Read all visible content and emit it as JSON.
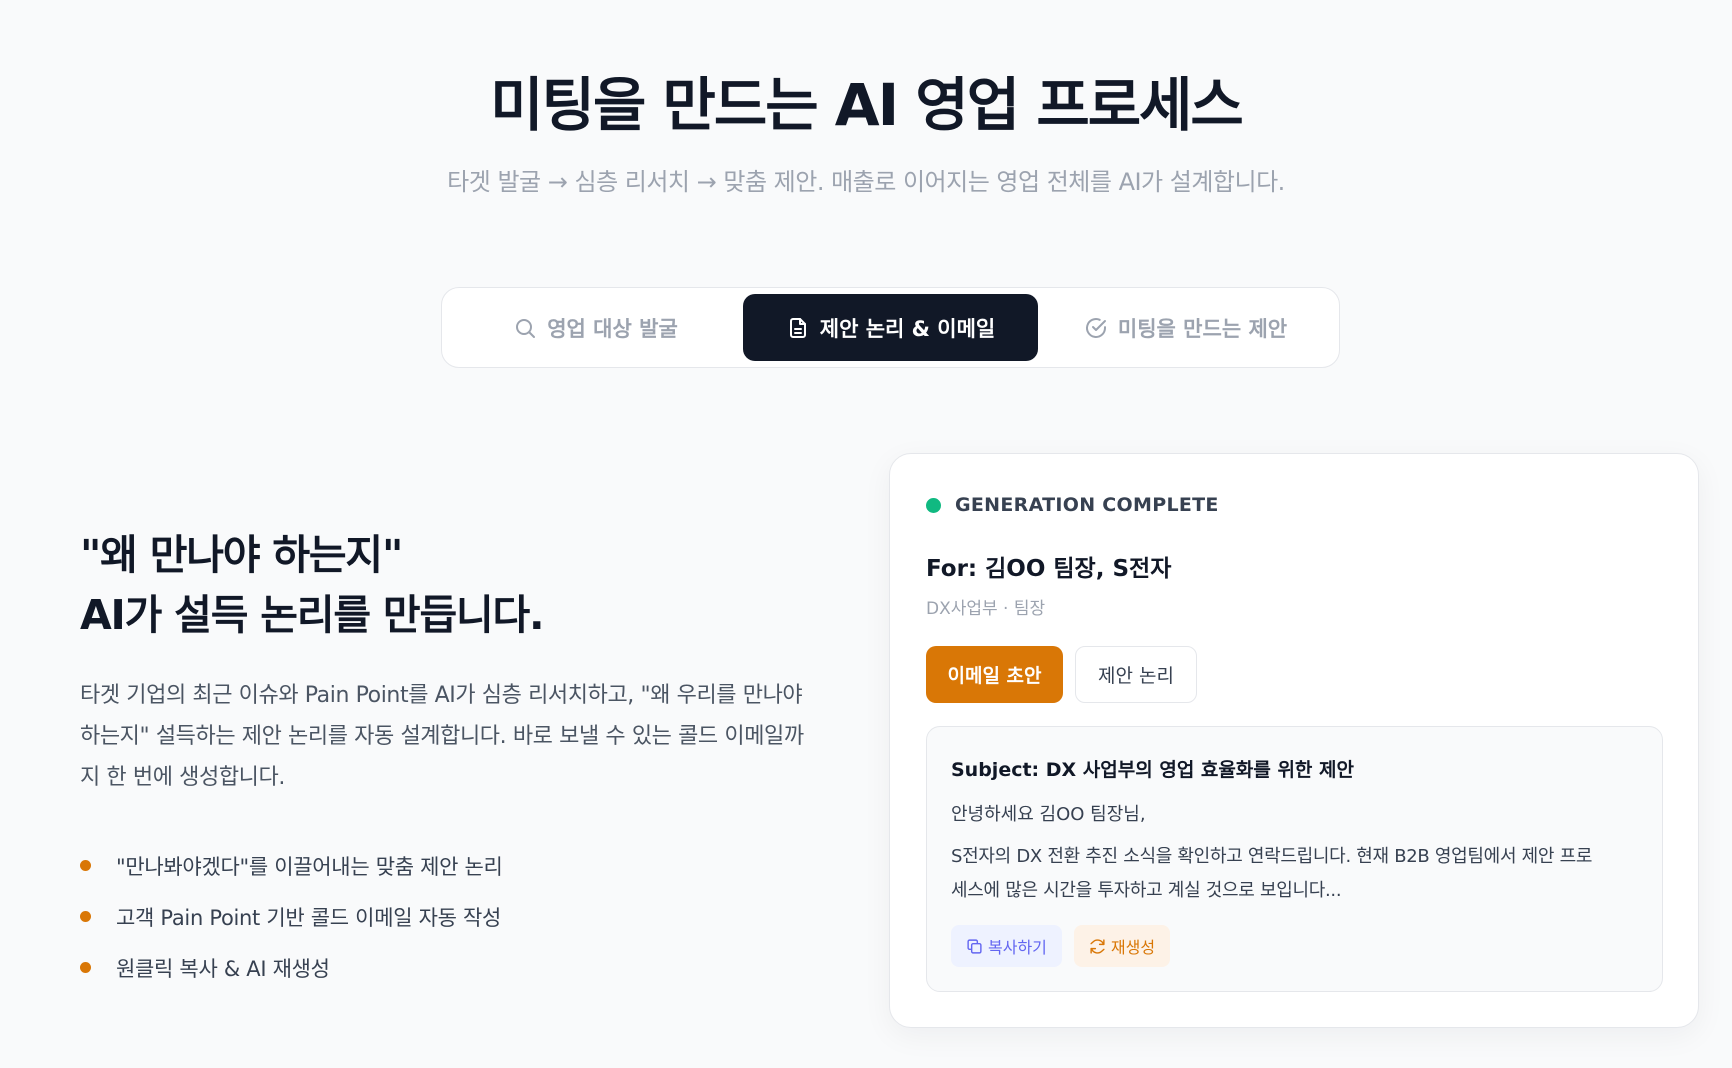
{
  "hero": {
    "title": "미팅을 만드는 AI 영업 프로세스",
    "subtitle": "타겟 발굴 → 심층 리서치 → 맞춤 제안. 매출로 이어지는 영업 전체를 AI가 설계합니다."
  },
  "tabs": [
    {
      "label": "영업 대상 발굴",
      "icon": "search-icon",
      "active": false
    },
    {
      "label": "제안 논리 & 이메일",
      "icon": "document-icon",
      "active": true
    },
    {
      "label": "미팅을 만드는 제안",
      "icon": "check-circle-icon",
      "active": false
    }
  ],
  "feature": {
    "heading_line1": "\"왜 만나야 하는지\"",
    "heading_line2": "AI가 설득 논리를 만듭니다.",
    "description": "타겟 기업의 최근 이슈와 Pain Point를 AI가 심층 리서치하고, \"왜 우리를 만나야 하는지\" 설득하는 제안 논리를 자동 설계합니다. 바로 보낼 수 있는 콜드 이메일까지 한 번에 생성합니다.",
    "bullets": [
      "\"만나봐야겠다\"를 이끌어내는 맞춤 제안 논리",
      "고객 Pain Point 기반 콜드 이메일 자동 작성",
      "원클릭 복사 & AI 재생성"
    ],
    "accent": "#d97706"
  },
  "card": {
    "status": "GENERATION COMPLETE",
    "status_color": "#10b981",
    "for_line": "For: 김OO 팀장, S전자",
    "dept": "DX사업부 · 팀장",
    "btn_email": "이메일 초안",
    "btn_logic": "제안 논리",
    "email": {
      "subject": "Subject: DX 사업부의 영업 효율화를 위한 제안",
      "greeting": "안녕하세요 김OO 팀장님,",
      "body": "S전자의 DX 전환 추진 소식을 확인하고 연락드립니다. 현재 B2B 영업팀에서 제안 프로세스에 많은 시간을 투자하고 계실 것으로 보입니다...",
      "copy_label": "복사하기",
      "regen_label": "재생성"
    }
  }
}
